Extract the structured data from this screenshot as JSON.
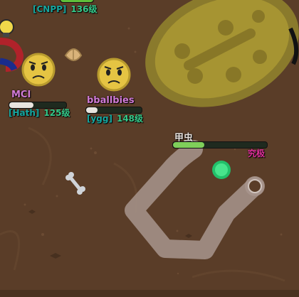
{
  "players": [
    {
      "guild": "[CNPP]",
      "level": "136级"
    },
    {
      "name": "MCI",
      "guild": "[Hath]",
      "level": "125级",
      "hp": 0.42
    },
    {
      "name": "bballbies",
      "guild": "[ygg]",
      "level": "148级",
      "hp": 0.2
    }
  ],
  "mob": {
    "name": "甲虫",
    "rarity": "究极",
    "hp": 0.33
  },
  "colors": {
    "ground": "#5a3d28",
    "flower": "#e5c443",
    "cactus": "#8a7a2c",
    "ant_trail": "#a8958d",
    "beetle_hp": "#7fcf5a",
    "player_hp": "#5fbf3a",
    "rarity": "#e0309a",
    "guild": "#16a7a0",
    "level": "#35c98a"
  },
  "items": [
    "bone-icon",
    "shell-icon",
    "bulb-icon",
    "magnet-icon"
  ]
}
